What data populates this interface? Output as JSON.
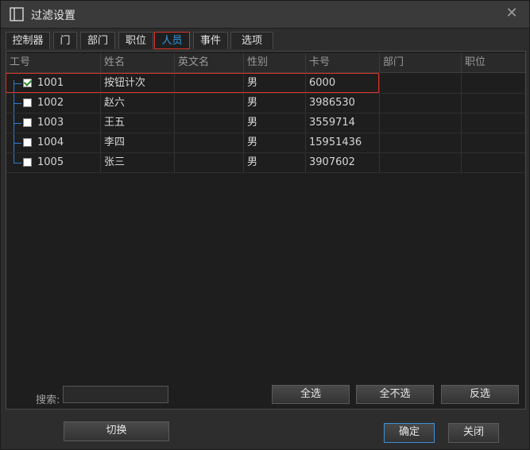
{
  "window": {
    "title": "过滤设置",
    "close_glyph": "✕"
  },
  "tabs": [
    {
      "label": "控制器",
      "active": false
    },
    {
      "label": "门",
      "active": false
    },
    {
      "label": "部门",
      "active": false
    },
    {
      "label": "职位",
      "active": false
    },
    {
      "label": "人员",
      "active": true
    },
    {
      "label": "事件",
      "active": false
    },
    {
      "label": "选项",
      "active": false
    }
  ],
  "table": {
    "columns": [
      "工号",
      "姓名",
      "英文名",
      "性别",
      "卡号",
      "部门",
      "职位"
    ],
    "rows": [
      {
        "checked": true,
        "id": "1001",
        "name": "按钮计次",
        "en": "",
        "sex": "男",
        "card": "6000",
        "dept": "",
        "pos": ""
      },
      {
        "checked": false,
        "id": "1002",
        "name": "赵六",
        "en": "",
        "sex": "男",
        "card": "3986530",
        "dept": "",
        "pos": ""
      },
      {
        "checked": false,
        "id": "1003",
        "name": "王五",
        "en": "",
        "sex": "男",
        "card": "3559714",
        "dept": "",
        "pos": ""
      },
      {
        "checked": false,
        "id": "1004",
        "name": "李四",
        "en": "",
        "sex": "男",
        "card": "15951436",
        "dept": "",
        "pos": ""
      },
      {
        "checked": false,
        "id": "1005",
        "name": "张三",
        "en": "",
        "sex": "男",
        "card": "3907602",
        "dept": "",
        "pos": ""
      }
    ]
  },
  "search": {
    "label": "搜索:",
    "value": ""
  },
  "buttons": {
    "select_all": "全选",
    "select_none": "全不选",
    "invert": "反选",
    "switch": "切换",
    "ok": "确定",
    "close": "关闭"
  },
  "colors": {
    "accent": "#2e9be8",
    "highlight_border": "#d9332a"
  }
}
